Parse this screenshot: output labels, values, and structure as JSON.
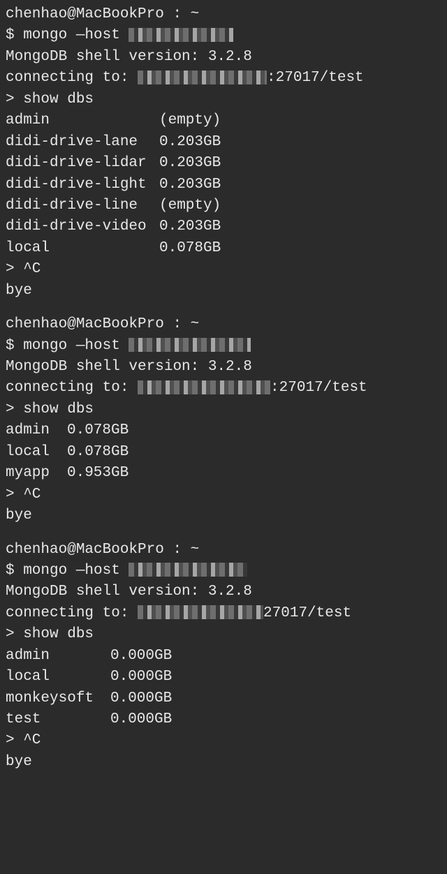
{
  "sessions": [
    {
      "prompt": "chenhao@MacBookPro : ~",
      "cmd_prefix": "$ mongo —host ",
      "host_redacted_width": 150,
      "shell_version": "MongoDB shell version: 3.2.8",
      "connecting_prefix": "connecting to: ",
      "connecting_redacted_width": 185,
      "connecting_suffix": ":27017/test",
      "show_dbs": "> show dbs",
      "name_col_width": 220,
      "dbs": [
        {
          "name": "admin",
          "size": "(empty)"
        },
        {
          "name": "didi-drive-lane",
          "size": "0.203GB"
        },
        {
          "name": "didi-drive-lidar",
          "size": "0.203GB"
        },
        {
          "name": "didi-drive-light",
          "size": "0.203GB"
        },
        {
          "name": "didi-drive-line",
          "size": "(empty)"
        },
        {
          "name": "didi-drive-video",
          "size": "0.203GB"
        },
        {
          "name": "local",
          "size": "0.078GB"
        }
      ],
      "ctrl_c": "> ^C",
      "bye": "bye"
    },
    {
      "prompt": "chenhao@MacBookPro : ~",
      "cmd_prefix": "$ mongo —host ",
      "host_redacted_width": 175,
      "shell_version": "MongoDB shell version: 3.2.8",
      "connecting_prefix": "connecting to: ",
      "connecting_redacted_width": 190,
      "connecting_suffix": ":27017/test",
      "show_dbs": "> show dbs",
      "name_col_width": 88,
      "dbs": [
        {
          "name": "admin",
          "size": "0.078GB"
        },
        {
          "name": "local",
          "size": "0.078GB"
        },
        {
          "name": "myapp",
          "size": "0.953GB"
        }
      ],
      "ctrl_c": "> ^C",
      "bye": "bye"
    },
    {
      "prompt": "chenhao@MacBookPro : ~",
      "cmd_prefix": "$ mongo —host ",
      "host_redacted_width": 170,
      "shell_version": "MongoDB shell version: 3.2.8",
      "connecting_prefix": "connecting to: ",
      "connecting_redacted_width": 180,
      "connecting_suffix": "27017/test",
      "show_dbs": "> show dbs",
      "name_col_width": 150,
      "dbs": [
        {
          "name": "admin",
          "size": "0.000GB"
        },
        {
          "name": "local",
          "size": "0.000GB"
        },
        {
          "name": "monkeysoft",
          "size": "0.000GB"
        },
        {
          "name": "test",
          "size": "0.000GB"
        }
      ],
      "ctrl_c": "> ^C",
      "bye": "bye"
    }
  ]
}
